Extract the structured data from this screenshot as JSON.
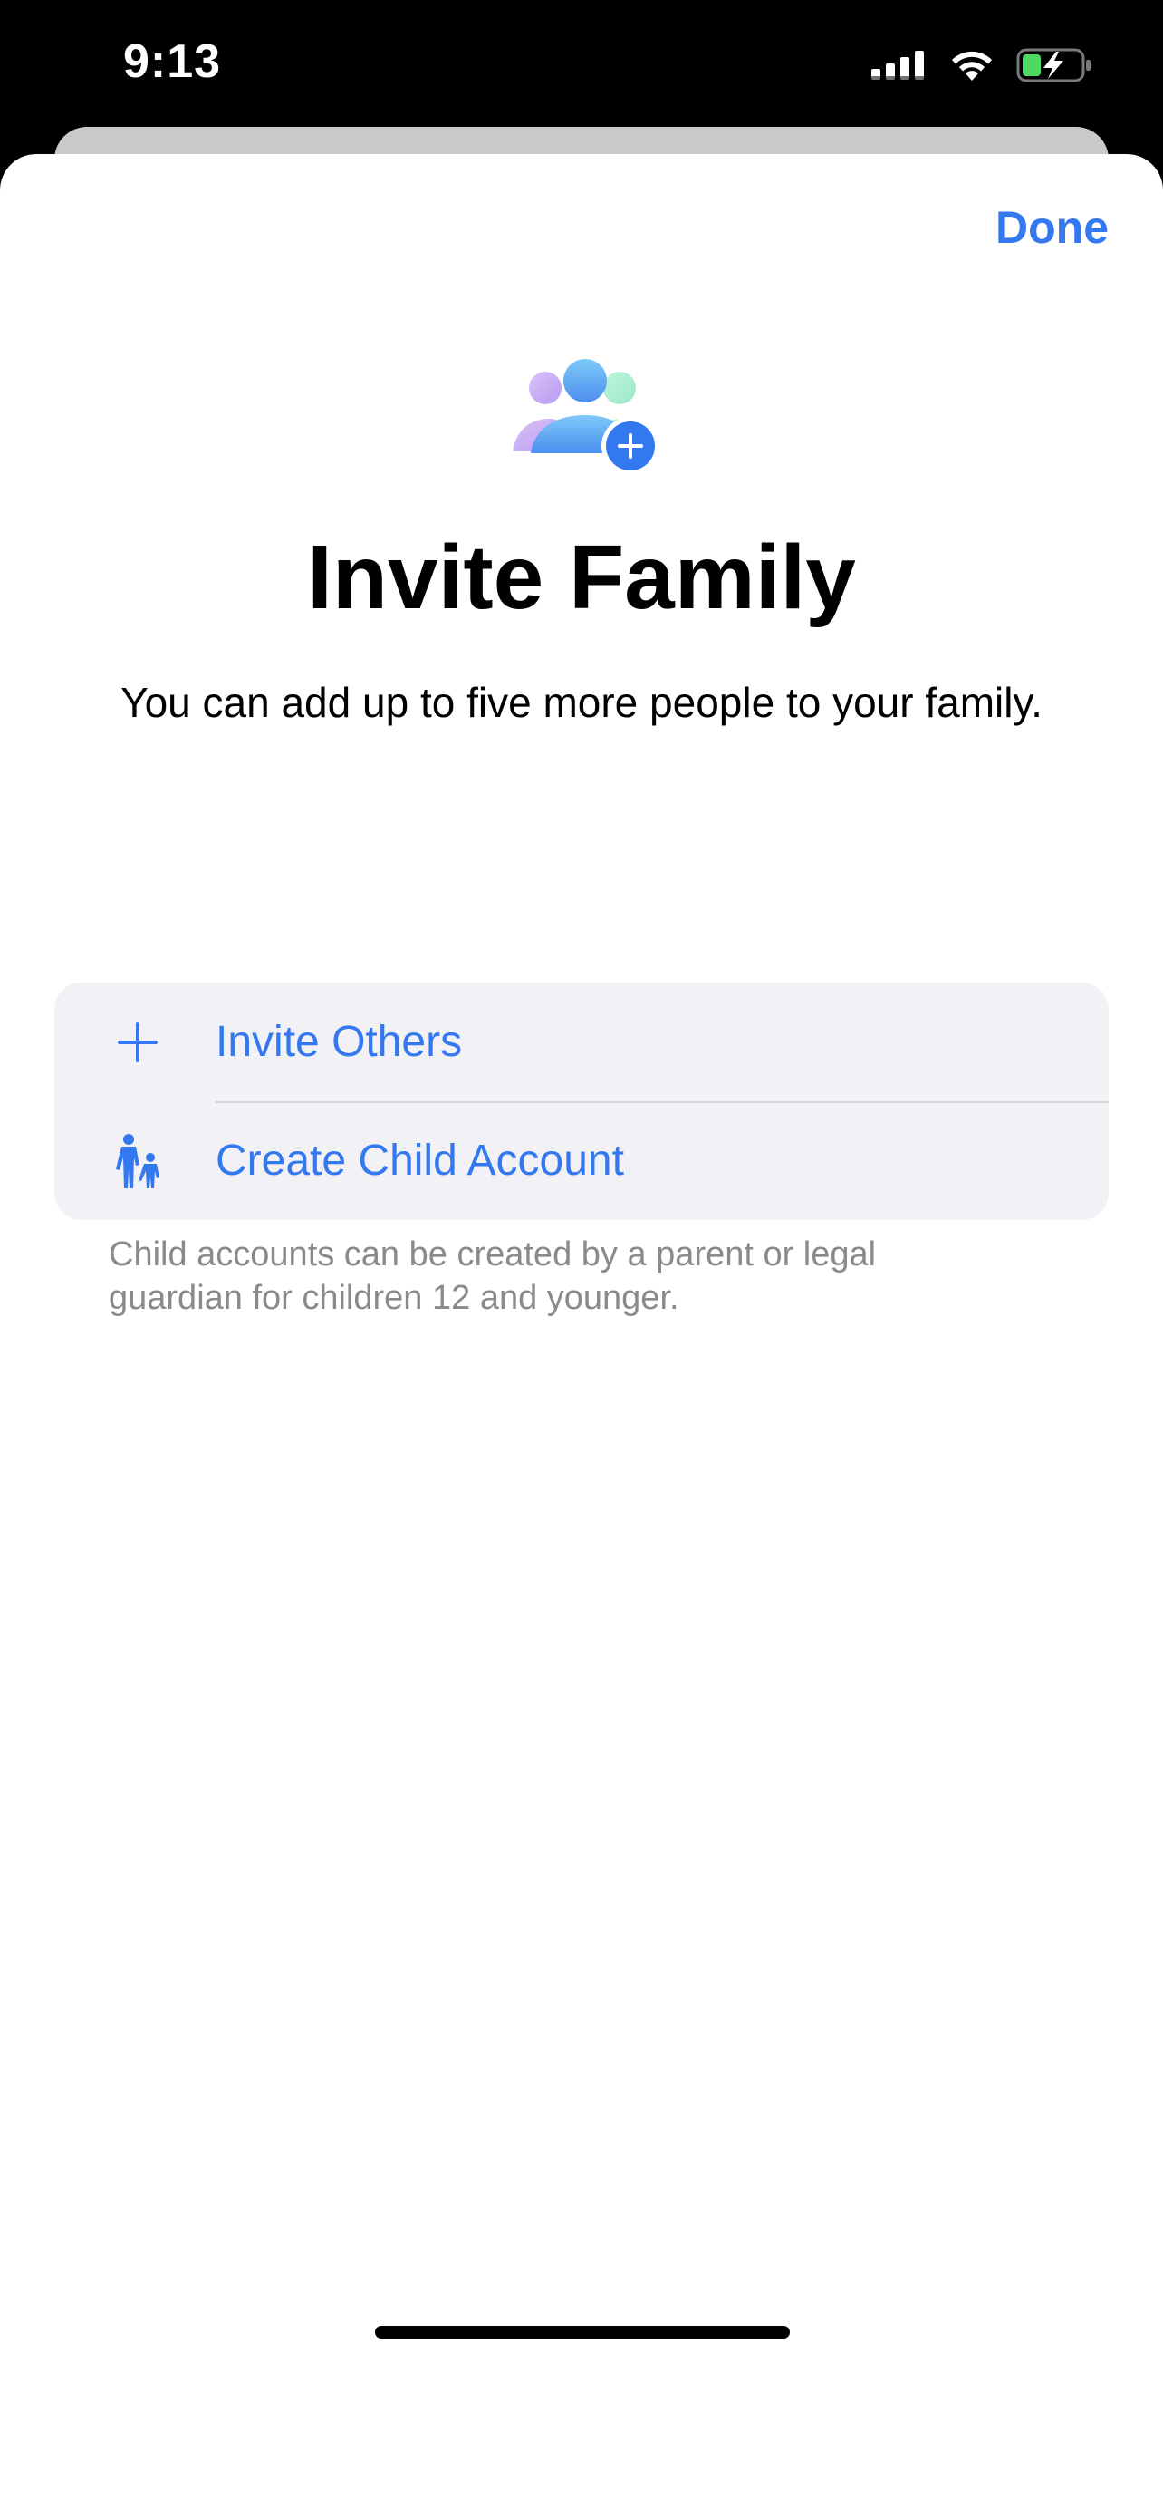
{
  "status_bar": {
    "time": "9:13",
    "signal_icon": "cellular-signal-icon",
    "wifi_icon": "wifi-icon",
    "battery_icon": "battery-charging-icon"
  },
  "sheet": {
    "done_label": "Done",
    "hero_icon": "family-add-icon",
    "title": "Invite Family",
    "subtitle": "You can add up to five more people to your family."
  },
  "options": [
    {
      "icon": "plus-icon",
      "label": "Invite Others"
    },
    {
      "icon": "adult-child-icon",
      "label": "Create Child Account"
    }
  ],
  "footnote": "Child accounts can be created by a parent or legal guardian for children 12 and younger.",
  "colors": {
    "accent": "#3478f0",
    "group_background": "#f1f1f6",
    "footnote_text": "#8a8a8e",
    "battery_fill": "#4cd964"
  }
}
